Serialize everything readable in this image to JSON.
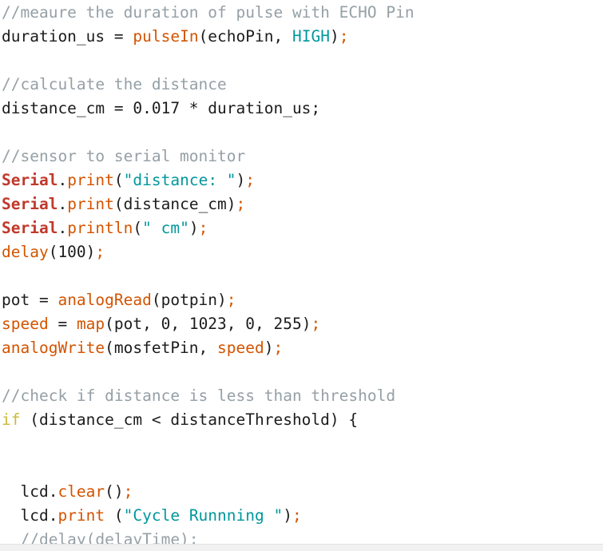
{
  "editor": {
    "language": "arduino",
    "colors": {
      "background": "#ffffff",
      "plain": "#1c1c1c",
      "comment": "#95a0a6",
      "function": "#d35400",
      "library": "#c0392b",
      "string": "#00979c",
      "literal": "#00979c",
      "keyword": "#c9bb3b",
      "variable": "#d35400"
    },
    "lines": [
      {
        "index": 0,
        "text": "//meaure the duration of pulse with ECHO Pin",
        "tokens": [
          {
            "t": "//meaure the duration of pulse with ECHO Pin",
            "c": "comment"
          }
        ]
      },
      {
        "index": 1,
        "text": "duration_us = pulseIn(echoPin, HIGH);",
        "tokens": [
          {
            "t": "duration_us = ",
            "c": "plain"
          },
          {
            "t": "pulseIn",
            "c": "function"
          },
          {
            "t": "(echoPin, ",
            "c": "plain"
          },
          {
            "t": "HIGH",
            "c": "literal"
          },
          {
            "t": ")",
            "c": "plain"
          },
          {
            "t": ";",
            "c": "semi"
          }
        ]
      },
      {
        "index": 2,
        "text": "",
        "tokens": []
      },
      {
        "index": 3,
        "text": "//calculate the distance",
        "tokens": [
          {
            "t": "//calculate the distance",
            "c": "comment"
          }
        ]
      },
      {
        "index": 4,
        "text": "distance_cm = 0.017 * duration_us;",
        "tokens": [
          {
            "t": "distance_cm = 0.017 * duration_us;",
            "c": "plain"
          }
        ]
      },
      {
        "index": 5,
        "text": "",
        "tokens": []
      },
      {
        "index": 6,
        "text": "//sensor to serial monitor",
        "tokens": [
          {
            "t": "//sensor to serial monitor",
            "c": "comment"
          }
        ]
      },
      {
        "index": 7,
        "text": "Serial.print(\"distance: \");",
        "tokens": [
          {
            "t": "Serial",
            "c": "library"
          },
          {
            "t": ".",
            "c": "plain"
          },
          {
            "t": "print",
            "c": "function"
          },
          {
            "t": "(",
            "c": "plain"
          },
          {
            "t": "\"distance: \"",
            "c": "string"
          },
          {
            "t": ")",
            "c": "plain"
          },
          {
            "t": ";",
            "c": "semi"
          }
        ]
      },
      {
        "index": 8,
        "text": "Serial.print(distance_cm);",
        "tokens": [
          {
            "t": "Serial",
            "c": "library"
          },
          {
            "t": ".",
            "c": "plain"
          },
          {
            "t": "print",
            "c": "function"
          },
          {
            "t": "(distance_cm)",
            "c": "plain"
          },
          {
            "t": ";",
            "c": "semi"
          }
        ]
      },
      {
        "index": 9,
        "text": "Serial.println(\" cm\");",
        "tokens": [
          {
            "t": "Serial",
            "c": "library"
          },
          {
            "t": ".",
            "c": "plain"
          },
          {
            "t": "println",
            "c": "function"
          },
          {
            "t": "(",
            "c": "plain"
          },
          {
            "t": "\" cm\"",
            "c": "string"
          },
          {
            "t": ")",
            "c": "plain"
          },
          {
            "t": ";",
            "c": "semi"
          }
        ]
      },
      {
        "index": 10,
        "text": "delay(100);",
        "tokens": [
          {
            "t": "delay",
            "c": "function"
          },
          {
            "t": "(100)",
            "c": "plain"
          },
          {
            "t": ";",
            "c": "semi"
          }
        ]
      },
      {
        "index": 11,
        "text": "",
        "tokens": []
      },
      {
        "index": 12,
        "text": "pot = analogRead(potpin);",
        "tokens": [
          {
            "t": "pot = ",
            "c": "plain"
          },
          {
            "t": "analogRead",
            "c": "function"
          },
          {
            "t": "(potpin)",
            "c": "plain"
          },
          {
            "t": ";",
            "c": "semi"
          }
        ]
      },
      {
        "index": 13,
        "text": "speed = map(pot, 0, 1023, 0, 255);",
        "tokens": [
          {
            "t": "speed",
            "c": "variable"
          },
          {
            "t": " = ",
            "c": "plain"
          },
          {
            "t": "map",
            "c": "function"
          },
          {
            "t": "(pot, 0, 1023, 0, 255)",
            "c": "plain"
          },
          {
            "t": ";",
            "c": "semi"
          }
        ]
      },
      {
        "index": 14,
        "text": "analogWrite(mosfetPin, speed);",
        "tokens": [
          {
            "t": "analogWrite",
            "c": "function"
          },
          {
            "t": "(mosfetPin, ",
            "c": "plain"
          },
          {
            "t": "speed",
            "c": "variable"
          },
          {
            "t": ")",
            "c": "plain"
          },
          {
            "t": ";",
            "c": "semi"
          }
        ]
      },
      {
        "index": 15,
        "text": "",
        "tokens": []
      },
      {
        "index": 16,
        "text": "//check if distance is less than threshold",
        "tokens": [
          {
            "t": "//check if distance is less than threshold",
            "c": "comment"
          }
        ]
      },
      {
        "index": 17,
        "text": "if (distance_cm < distanceThreshold) {",
        "tokens": [
          {
            "t": "if",
            "c": "keyword"
          },
          {
            "t": " (distance_cm < distanceThreshold) {",
            "c": "plain"
          }
        ]
      },
      {
        "index": 18,
        "text": "",
        "tokens": []
      },
      {
        "index": 19,
        "text": "",
        "tokens": []
      },
      {
        "index": 20,
        "text": "  lcd.clear();",
        "tokens": [
          {
            "t": "  lcd.",
            "c": "plain"
          },
          {
            "t": "clear",
            "c": "function"
          },
          {
            "t": "()",
            "c": "plain"
          },
          {
            "t": ";",
            "c": "semi"
          }
        ]
      },
      {
        "index": 21,
        "text": "  lcd.print (\"Cycle Runnning \");",
        "tokens": [
          {
            "t": "  lcd.",
            "c": "plain"
          },
          {
            "t": "print",
            "c": "function"
          },
          {
            "t": " (",
            "c": "plain"
          },
          {
            "t": "\"Cycle Runnning \"",
            "c": "string"
          },
          {
            "t": ")",
            "c": "plain"
          },
          {
            "t": ";",
            "c": "semi"
          }
        ]
      },
      {
        "index": 22,
        "text": "  //delay(delayTime);",
        "tokens": [
          {
            "t": "  //delay(delayTime);",
            "c": "comment"
          }
        ]
      }
    ]
  }
}
